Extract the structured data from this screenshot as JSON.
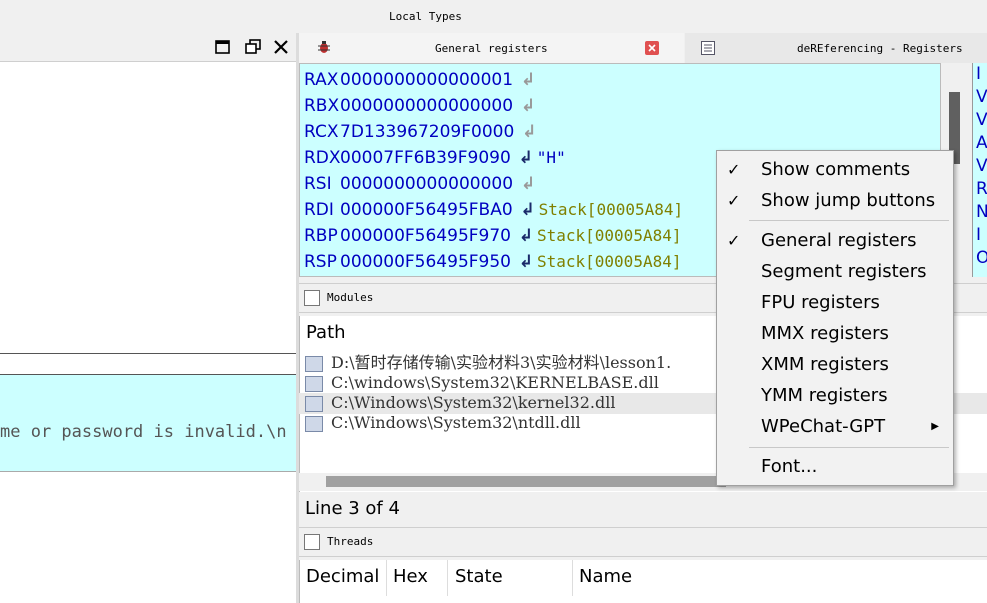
{
  "top": {
    "title": "Local Types"
  },
  "left": {
    "message_text": "me or password is invalid.\\n"
  },
  "tabs": [
    {
      "label": "General registers"
    },
    {
      "label": "deREferencing - Registers"
    }
  ],
  "registers": [
    {
      "name": "RAX",
      "value": "0000000000000001",
      "comment": ""
    },
    {
      "name": "RBX",
      "value": "0000000000000000",
      "comment": ""
    },
    {
      "name": "RCX",
      "value": "7D133967209F0000",
      "comment": ""
    },
    {
      "name": "RDX",
      "value": "00007FF6B39F9090",
      "comment": "\"H\""
    },
    {
      "name": "RSI",
      "value": "0000000000000000",
      "comment": ""
    },
    {
      "name": "RDI",
      "value": "000000F56495FBA0",
      "comment": "Stack[00005A84]"
    },
    {
      "name": "RBP",
      "value": "000000F56495F970",
      "comment": "Stack[00005A84]"
    },
    {
      "name": "RSP",
      "value": "000000F56495F950",
      "comment": "Stack[00005A84]"
    }
  ],
  "right_column_letters": [
    "I",
    "V",
    "V",
    "A",
    "V",
    "R",
    "N",
    "I",
    "O"
  ],
  "modules": {
    "title": "Modules",
    "column_path": "Path",
    "rows": [
      "D:\\暂时存储传输\\实验材料3\\实验材料\\lesson1.",
      "C:\\windows\\System32\\KERNELBASE.dll",
      "C:\\Windows\\System32\\kernel32.dll",
      "C:\\Windows\\System32\\ntdll.dll"
    ],
    "status": "Line 3 of 4"
  },
  "threads": {
    "title": "Threads",
    "columns": [
      "Decimal",
      "Hex",
      "State",
      "Name"
    ]
  },
  "menu": {
    "items": [
      {
        "label": "Show comments",
        "checked": true
      },
      {
        "label": "Show jump buttons",
        "checked": true
      },
      {
        "label": "General registers",
        "checked": true
      },
      {
        "label": "Segment registers",
        "checked": false
      },
      {
        "label": "FPU registers",
        "checked": false
      },
      {
        "label": "MMX registers",
        "checked": false
      },
      {
        "label": "XMM registers",
        "checked": false
      },
      {
        "label": "YMM registers",
        "checked": false
      },
      {
        "label": "WPeChat-GPT",
        "checked": false
      },
      {
        "label": "Font...",
        "checked": false
      }
    ],
    "check_glyph": "✓",
    "submenu_glyph": "▶"
  },
  "colors": {
    "register_bg": "#ccffff",
    "register_text": "#0000c0",
    "comment_text": "#808000",
    "close_tab": "#e05050"
  }
}
